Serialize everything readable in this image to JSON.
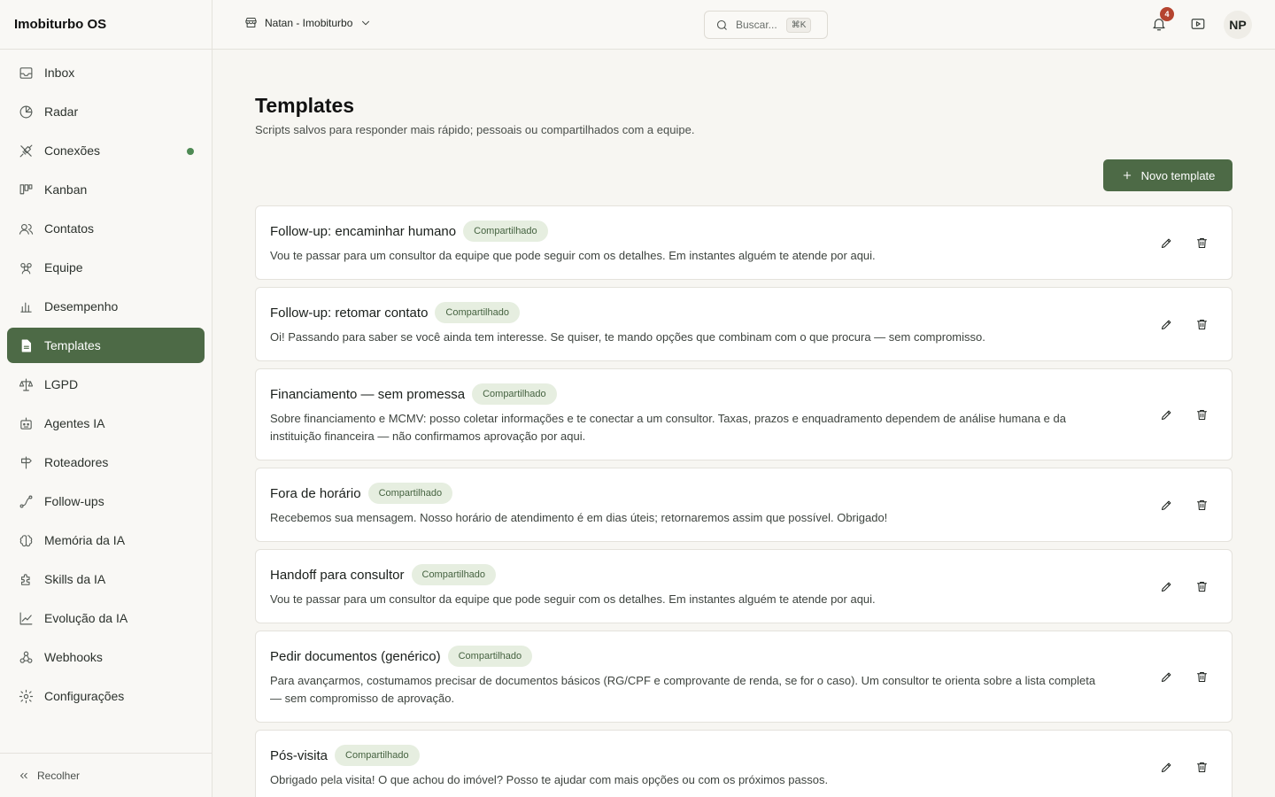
{
  "app": {
    "title": "Imobiturbo OS"
  },
  "sidebar": {
    "items": [
      {
        "label": "Inbox",
        "icon": "inbox-icon"
      },
      {
        "label": "Radar",
        "icon": "radar-icon"
      },
      {
        "label": "Conexões",
        "icon": "plug-icon",
        "status_dot": "#4e8a54"
      },
      {
        "label": "Kanban",
        "icon": "kanban-icon"
      },
      {
        "label": "Contatos",
        "icon": "contacts-icon"
      },
      {
        "label": "Equipe",
        "icon": "team-icon"
      },
      {
        "label": "Desempenho",
        "icon": "bar-chart-icon"
      },
      {
        "label": "Templates",
        "icon": "file-text-icon",
        "active": true
      },
      {
        "label": "LGPD",
        "icon": "scale-icon"
      },
      {
        "label": "Agentes IA",
        "icon": "bot-icon"
      },
      {
        "label": "Roteadores",
        "icon": "signpost-icon"
      },
      {
        "label": "Follow-ups",
        "icon": "route-icon"
      },
      {
        "label": "Memória da IA",
        "icon": "brain-icon"
      },
      {
        "label": "Skills da IA",
        "icon": "puzzle-icon"
      },
      {
        "label": "Evolução da IA",
        "icon": "trend-icon"
      },
      {
        "label": "Webhooks",
        "icon": "webhook-icon"
      },
      {
        "label": "Configurações",
        "icon": "gear-icon"
      }
    ],
    "collapse_label": "Recolher"
  },
  "topbar": {
    "workspace": "Natan - Imobiturbo",
    "search_placeholder": "Buscar...",
    "search_shortcut": "⌘K",
    "notifications_count": "4",
    "avatar_initials": "NP"
  },
  "main": {
    "title": "Templates",
    "subtitle": "Scripts salvos para responder mais rápido; pessoais ou compartilhados com a equipe.",
    "new_button": "Novo template",
    "templates": [
      {
        "title": "Follow-up: encaminhar humano",
        "badge": "Compartilhado",
        "body": "Vou te passar para um consultor da equipe que pode seguir com os detalhes. Em instantes alguém te atende por aqui."
      },
      {
        "title": "Follow-up: retomar contato",
        "badge": "Compartilhado",
        "body": "Oi! Passando para saber se você ainda tem interesse. Se quiser, te mando opções que combinam com o que procura — sem compromisso."
      },
      {
        "title": "Financiamento — sem promessa",
        "badge": "Compartilhado",
        "body": "Sobre financiamento e MCMV: posso coletar informações e te conectar a um consultor. Taxas, prazos e enquadramento dependem de análise humana e da instituição financeira — não confirmamos aprovação por aqui."
      },
      {
        "title": "Fora de horário",
        "badge": "Compartilhado",
        "body": "Recebemos sua mensagem. Nosso horário de atendimento é em dias úteis; retornaremos assim que possível. Obrigado!"
      },
      {
        "title": "Handoff para consultor",
        "badge": "Compartilhado",
        "body": "Vou te passar para um consultor da equipe que pode seguir com os detalhes. Em instantes alguém te atende por aqui."
      },
      {
        "title": "Pedir documentos (genérico)",
        "badge": "Compartilhado",
        "body": "Para avançarmos, costumamos precisar de documentos básicos (RG/CPF e comprovante de renda, se for o caso). Um consultor te orienta sobre a lista completa — sem compromisso de aprovação."
      },
      {
        "title": "Pós-visita",
        "badge": "Compartilhado",
        "body": "Obrigado pela visita! O que achou do imóvel? Posso te ajudar com mais opções ou com os próximos passos."
      }
    ]
  },
  "colors": {
    "accent": "#4d6a46",
    "badge_bg": "#e6eee0",
    "notification": "#b5442f"
  }
}
